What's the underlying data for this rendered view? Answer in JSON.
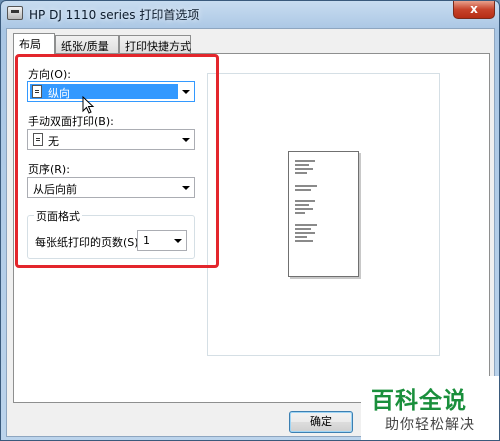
{
  "window": {
    "title": "HP DJ 1110 series 打印首选项",
    "close_label": "x"
  },
  "tabs": [
    {
      "label": "布局",
      "active": true
    },
    {
      "label": "纸张/质量",
      "active": false
    },
    {
      "label": "打印快捷方式",
      "active": false
    }
  ],
  "layout": {
    "orientation": {
      "label": "方向(O):",
      "value": "纵向",
      "icon": "portrait-page-icon"
    },
    "duplex": {
      "label": "手动双面打印(B):",
      "value": "无",
      "icon": "page-icon"
    },
    "page_order": {
      "label": "页序(R):",
      "value": "从后向前"
    },
    "page_format": {
      "group_label": "页面格式",
      "pages_per_sheet_label": "每张纸打印的页数(S)",
      "pages_per_sheet_value": "1"
    }
  },
  "buttons": {
    "ok": "确定",
    "advanced": ""
  },
  "watermark": {
    "main": "百科全说",
    "sub": "助你轻松解决"
  },
  "colors": {
    "highlight": "#e3262c",
    "selection": "#3399ff",
    "watermark_green": "#1a8f3c"
  }
}
